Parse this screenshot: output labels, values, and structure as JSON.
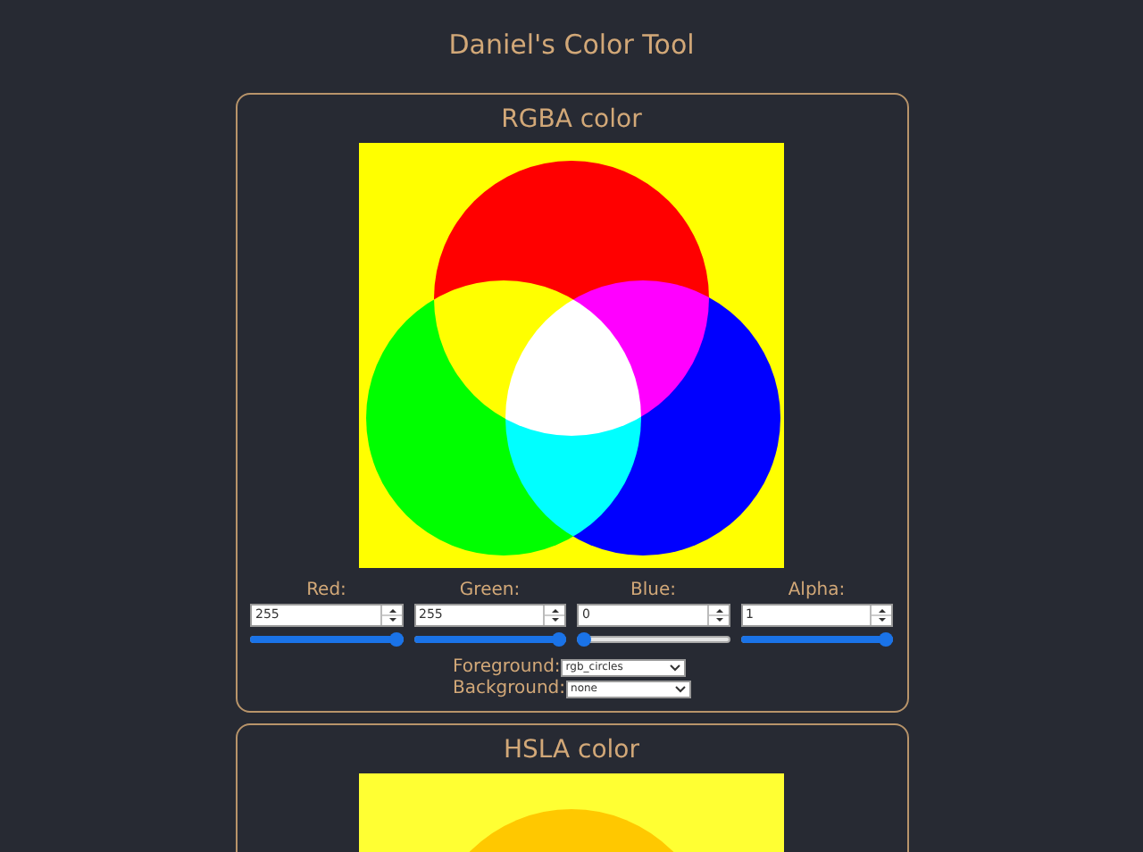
{
  "title": "Daniel's Color Tool",
  "cards": [
    {
      "title": "RGBA color",
      "kind": "rgba",
      "channels": [
        {
          "label": "Red:",
          "value": "255",
          "level": 1
        },
        {
          "label": "Green:",
          "value": "255",
          "level": 1
        },
        {
          "label": "Blue:",
          "value": "0",
          "level": 0
        },
        {
          "label": "Alpha:",
          "value": "1",
          "level": 1
        }
      ],
      "selects": [
        {
          "label": "Foreground:",
          "value": "rgb_circles"
        },
        {
          "label": "Background:",
          "value": "none"
        }
      ]
    },
    {
      "title": "HSLA color",
      "kind": "hsla"
    }
  ]
}
